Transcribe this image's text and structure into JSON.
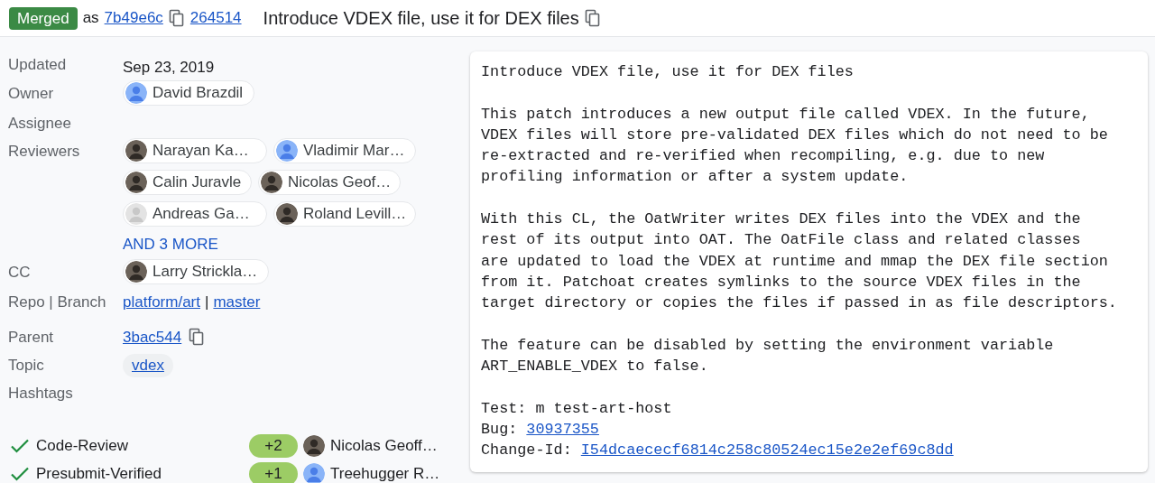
{
  "header": {
    "status": "Merged",
    "as_text": "as",
    "commit": "7b49e6c",
    "change_number": "264514",
    "title": "Introduce VDEX file, use it for DEX files"
  },
  "info": [
    {
      "label": "Updated",
      "kind": "text",
      "value": "Sep 23, 2019"
    },
    {
      "label": "Owner",
      "kind": "people",
      "people": [
        {
          "name": "David Brazdil",
          "kind": "default"
        }
      ]
    },
    {
      "label": "Assignee",
      "kind": "empty"
    },
    {
      "label": "Reviewers",
      "kind": "people",
      "people": [
        {
          "name": "Narayan Ka…",
          "kind": "photo"
        },
        {
          "name": "Vladimir Mar…",
          "kind": "default"
        },
        {
          "name": "Calin Juravle",
          "kind": "photo"
        },
        {
          "name": "Nicolas Geof…",
          "kind": "photo"
        },
        {
          "name": "Andreas Ga…",
          "kind": "blank"
        },
        {
          "name": "Roland Levill…",
          "kind": "photo"
        }
      ],
      "more": "AND 3 MORE"
    },
    {
      "label": "CC",
      "kind": "people",
      "people": [
        {
          "name": "Larry Strickla…",
          "kind": "photo"
        }
      ]
    },
    {
      "label": "Repo | Branch",
      "kind": "repo",
      "repo": "platform/art",
      "separator": "|",
      "branch": "master"
    },
    {
      "label": "Parent",
      "kind": "parent",
      "value": "3bac544"
    },
    {
      "label": "Topic",
      "kind": "topic",
      "value": "vdex"
    },
    {
      "label": "Hashtags",
      "kind": "empty"
    }
  ],
  "votes": [
    {
      "label": "Code-Review",
      "score": "+2",
      "voter": "Nicolas Geoff…",
      "kind": "photo"
    },
    {
      "label": "Presubmit-Verified",
      "score": "+1",
      "voter": "Treehugger R…",
      "kind": "default"
    }
  ],
  "message": [
    [
      {
        "text": "Introduce VDEX file, use it for DEX files"
      }
    ],
    [
      {
        "text": "This patch introduces a new output file called VDEX. In the future,"
      },
      {
        "text": "VDEX files will store pre-validated DEX files which do not need to be"
      },
      {
        "text": "re-extracted and re-verified when recompiling, e.g. due to new"
      },
      {
        "text": "profiling information or after a system update."
      }
    ],
    [
      {
        "text": "With this CL, the OatWriter writes DEX files into the VDEX and the"
      },
      {
        "text": "rest of its output into OAT. The OatFile class and related classes"
      },
      {
        "text": "are updated to load the VDEX at runtime and mmap the DEX file section"
      },
      {
        "text": "from it. Patchoat creates symlinks to the source VDEX files in the"
      },
      {
        "text": "target directory or copies the files if passed in as file descriptors."
      }
    ],
    [
      {
        "text": "The feature can be disabled by setting the environment variable"
      },
      {
        "text": "ART_ENABLE_VDEX to false."
      }
    ],
    [
      {
        "text": "Test: m test-art-host"
      },
      {
        "text": "Bug: ",
        "link": "30937355"
      },
      {
        "text": "Change-Id: ",
        "link": "I54dcaececf6814c258c80524ec15e2e2ef69c8dd"
      }
    ]
  ]
}
